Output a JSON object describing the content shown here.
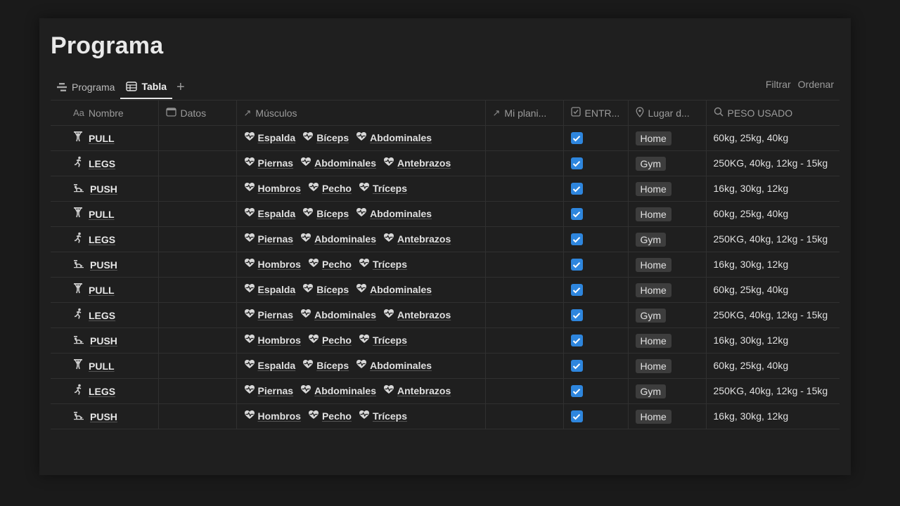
{
  "page": {
    "title": "Programa"
  },
  "views": {
    "tabs": [
      {
        "label": "Programa",
        "icon": "timeline-icon"
      },
      {
        "label": "Tabla",
        "icon": "table-icon"
      }
    ],
    "add_label": "+",
    "filter_label": "Filtrar",
    "sort_label": "Ordenar"
  },
  "table": {
    "columns": [
      {
        "icon_text": "Aa",
        "label": "Nombre"
      },
      {
        "icon_text": "",
        "label": "Datos"
      },
      {
        "icon_text": "↗",
        "label": "Músculos"
      },
      {
        "icon_text": "↗",
        "label": "Mi plani..."
      },
      {
        "icon_text": "",
        "label": "ENTR..."
      },
      {
        "icon_text": "",
        "label": "Lugar d..."
      },
      {
        "icon_text": "",
        "label": "PESO USADO"
      }
    ],
    "rows": [
      {
        "name": "PULL",
        "muscles": [
          "Espalda",
          "Bíceps",
          "Abdominales"
        ],
        "checked": true,
        "place": "Home",
        "peso": "60kg, 25kg, 40kg"
      },
      {
        "name": "LEGS",
        "muscles": [
          "Piernas",
          "Abdominales",
          "Antebrazos"
        ],
        "checked": true,
        "place": "Gym",
        "peso": "250KG, 40kg, 12kg - 15kg"
      },
      {
        "name": "PUSH",
        "muscles": [
          "Hombros",
          "Pecho",
          "Tríceps"
        ],
        "checked": true,
        "place": "Home",
        "peso": "16kg, 30kg, 12kg"
      },
      {
        "name": "PULL",
        "muscles": [
          "Espalda",
          "Bíceps",
          "Abdominales"
        ],
        "checked": true,
        "place": "Home",
        "peso": "60kg, 25kg, 40kg"
      },
      {
        "name": "LEGS",
        "muscles": [
          "Piernas",
          "Abdominales",
          "Antebrazos"
        ],
        "checked": true,
        "place": "Gym",
        "peso": "250KG, 40kg, 12kg - 15kg"
      },
      {
        "name": "PUSH",
        "muscles": [
          "Hombros",
          "Pecho",
          "Tríceps"
        ],
        "checked": true,
        "place": "Home",
        "peso": "16kg, 30kg, 12kg"
      },
      {
        "name": "PULL",
        "muscles": [
          "Espalda",
          "Bíceps",
          "Abdominales"
        ],
        "checked": true,
        "place": "Home",
        "peso": "60kg, 25kg, 40kg"
      },
      {
        "name": "LEGS",
        "muscles": [
          "Piernas",
          "Abdominales",
          "Antebrazos"
        ],
        "checked": true,
        "place": "Gym",
        "peso": "250KG, 40kg, 12kg - 15kg"
      },
      {
        "name": "PUSH",
        "muscles": [
          "Hombros",
          "Pecho",
          "Tríceps"
        ],
        "checked": true,
        "place": "Home",
        "peso": "16kg, 30kg, 12kg"
      },
      {
        "name": "PULL",
        "muscles": [
          "Espalda",
          "Bíceps",
          "Abdominales"
        ],
        "checked": true,
        "place": "Home",
        "peso": "60kg, 25kg, 40kg"
      },
      {
        "name": "LEGS",
        "muscles": [
          "Piernas",
          "Abdominales",
          "Antebrazos"
        ],
        "checked": true,
        "place": "Gym",
        "peso": "250KG, 40kg, 12kg - 15kg"
      },
      {
        "name": "PUSH",
        "muscles": [
          "Hombros",
          "Pecho",
          "Tríceps"
        ],
        "checked": true,
        "place": "Home",
        "peso": "16kg, 30kg, 12kg"
      }
    ]
  },
  "colors": {
    "checkbox": "#2e86de",
    "tag_bg": "#3d3d3d",
    "background": "#1f1f1f"
  }
}
